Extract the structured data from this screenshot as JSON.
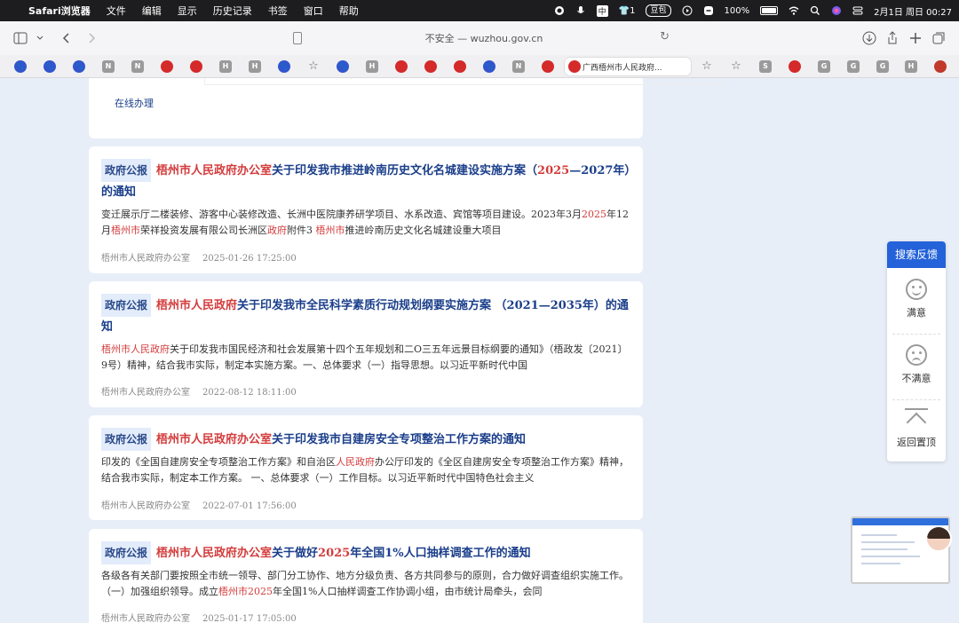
{
  "menubar": {
    "app_name": "Safari浏览器",
    "menus": [
      "文件",
      "编辑",
      "显示",
      "历史记录",
      "书签",
      "窗口",
      "帮助"
    ],
    "input_method": "中",
    "badge_count": "1",
    "badge_label": "豆包",
    "battery": "100%",
    "datetime": "2月1日 周日 00:27"
  },
  "address_bar": {
    "text": "不安全 — wuzhou.gov.cn"
  },
  "favorites": {
    "letters": {
      "n": "N",
      "h": "H",
      "s": "S",
      "g": "G"
    },
    "star": "☆",
    "active_tab": "广西梧州市人民政府..."
  },
  "top_card": {
    "link": "在线办理"
  },
  "results": [
    {
      "tag": "政府公报",
      "title_hl1": "梧州市人民政府办公室",
      "title_p1": "关于印发我市推进岭南历史文化名城建设实施方案（",
      "title_hl2": "2025",
      "title_p2": "—2027年）的通知",
      "snip_p1": "变迁展示厅二楼装修、游客中心装修改造、长洲中医院康养研学项目、水系改造、宾馆等项目建设。2023年3月",
      "snip_hl1": "2025",
      "snip_p2": "年12月",
      "snip_hl2": "梧州市",
      "snip_p3": "荣祥投资发展有限公司长洲区",
      "snip_hl3": "政府",
      "snip_p4": "附件3 ",
      "snip_hl4": "梧州市",
      "snip_p5": "推进岭南历史文化名城建设重大项目",
      "source": "梧州市人民政府办公室",
      "date": "2025-01-26 17:25:00"
    },
    {
      "tag": "政府公报",
      "title_hl1": "梧州市人民政府",
      "title_p1": "关于印发我市全民科学素质行动规划纲要实施方案 （2021—2035年）的通知",
      "snip_hl1": "梧州市人民政府",
      "snip_p1": "关于印发我市国民经济和社会发展第十四个五年规划和二O三五年远景目标纲要的通知》（梧政发〔2021〕9号）精神，结合我市实际，制定本实施方案。一、总体要求（一）指导思想。以习近平新时代中国",
      "source": "梧州市人民政府办公室",
      "date": "2022-08-12 18:11:00"
    },
    {
      "tag": "政府公报",
      "title_hl1": "梧州市人民政府办公室",
      "title_p1": "关于印发我市自建房安全专项整治工作方案的通知",
      "snip_p1": "印发的《全国自建房安全专项整治工作方案》和自治区",
      "snip_hl1": "人民政府",
      "snip_p2": "办公厅印发的《全区自建房安全专项整治工作方案》精神，结合我市实际，制定本工作方案。 一、总体要求（一）工作目标。以习近平新时代中国特色社会主义",
      "source": "梧州市人民政府办公室",
      "date": "2022-07-01 17:56:00"
    },
    {
      "tag": "政府公报",
      "title_hl1": "梧州市人民政府办公室",
      "title_p1": "关于做好",
      "title_hl2": "2025",
      "title_p2": "年全国1%人口抽样调查工作的通知",
      "snip_p1": "各级各有关部门要按照全市统一领导、部门分工协作、地方分级负责、各方共同参与的原则，合力做好调查组织实施工作。（一）加强组织领导。成立",
      "snip_hl1": "梧州市2025",
      "snip_p2": "年全国1%人口抽样调查工作协调小组，由市统计局牵头，会同",
      "source": "梧州市人民政府办公室",
      "date": "2025-01-17 17:05:00"
    }
  ],
  "feedback": {
    "header": "搜索反馈",
    "satisfied": "满意",
    "unsatisfied": "不满意",
    "back_to_top": "返回置顶"
  }
}
